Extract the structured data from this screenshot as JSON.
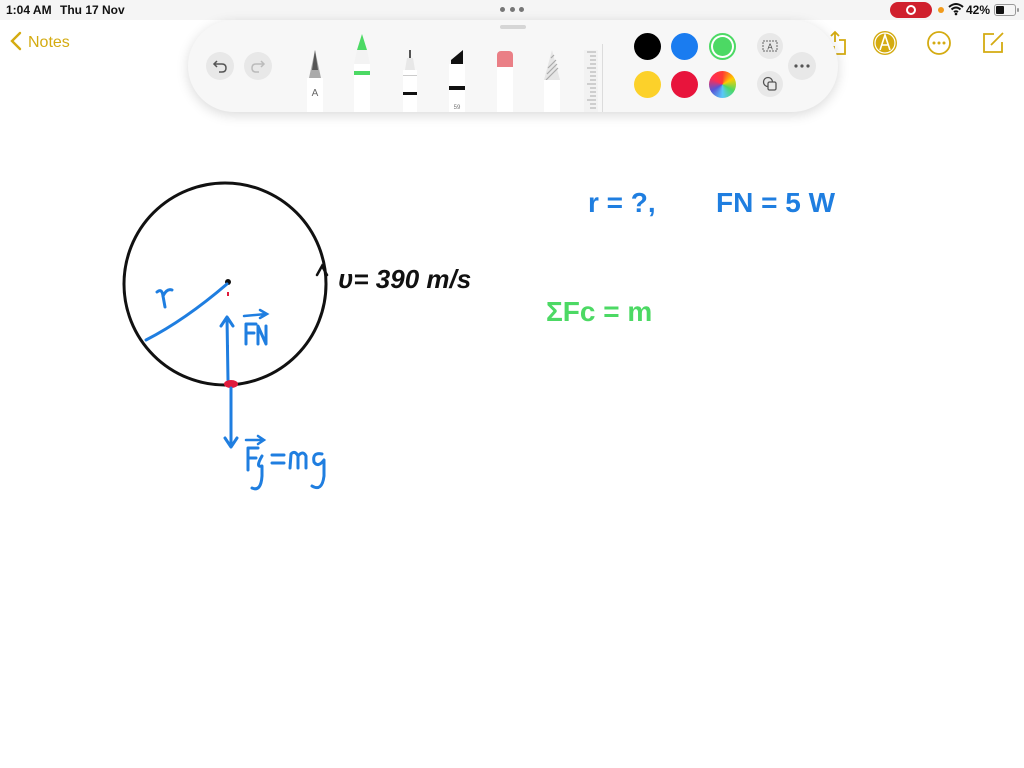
{
  "status_bar": {
    "time": "1:04 AM",
    "date": "Thu 17 Nov",
    "battery_percent_label": "42%",
    "battery_level": 0.42,
    "recording": true
  },
  "nav": {
    "back_label": "Notes",
    "accent_color": "#d4ab11"
  },
  "toolbar_icons": [
    "share-icon",
    "markup-icon",
    "more-icon",
    "compose-icon"
  ],
  "palette": {
    "undo_icon": "undo-icon",
    "redo_icon": "redo-icon",
    "tools": [
      {
        "name": "pen",
        "label": "A"
      },
      {
        "name": "marker",
        "selected": true
      },
      {
        "name": "fineliner"
      },
      {
        "name": "highlighter",
        "label": "59"
      },
      {
        "name": "eraser"
      },
      {
        "name": "pencil"
      },
      {
        "name": "ruler"
      }
    ],
    "colors": [
      {
        "name": "black",
        "hex": "#000000"
      },
      {
        "name": "blue",
        "hex": "#1a7cf0"
      },
      {
        "name": "green",
        "hex": "#4cd964",
        "selected": true
      },
      {
        "name": "yellow",
        "hex": "#fcd12a"
      },
      {
        "name": "red",
        "hex": "#e8143c"
      },
      {
        "name": "multicolor",
        "hex": "conic"
      }
    ],
    "text_box_icon_label": "A"
  },
  "drawing": {
    "velocity_label": "υ= 390 m/s",
    "radius_label": "r",
    "normal_force_label": "FN",
    "gravity_label": "Fg = mg",
    "given_r": "r = ?,",
    "given_fn": "FN = 5 W",
    "sum_forces": "ΣFc = m",
    "colors": {
      "ink_black": "#111111",
      "ink_blue": "#1f7ee0",
      "ink_green": "#4cd964",
      "ink_red": "#e01a3c"
    }
  }
}
